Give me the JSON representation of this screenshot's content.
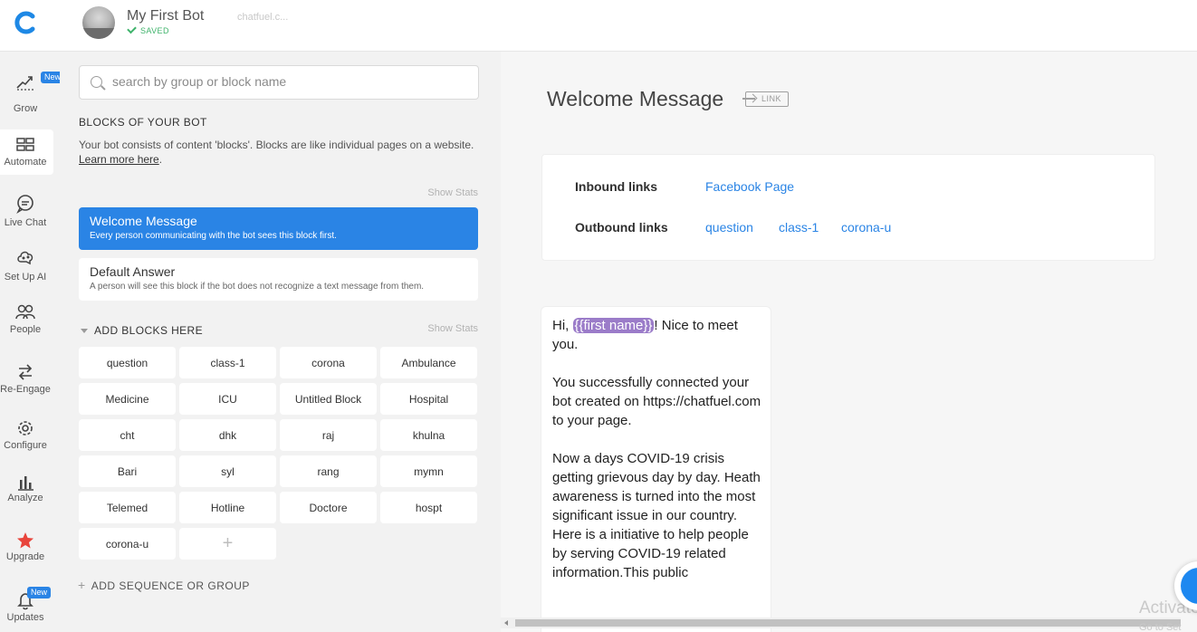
{
  "topbar": {
    "bot_name": "My First Bot",
    "saved": "SAVED",
    "bot_url": "chatfuel.c..."
  },
  "nav": {
    "items": [
      {
        "label": "Grow",
        "icon": "grow-icon",
        "badge": "New"
      },
      {
        "label": "Automate",
        "icon": "automate-icon",
        "active": true
      },
      {
        "label": "Live Chat",
        "icon": "chat-bubble-icon"
      },
      {
        "label": "Set Up AI",
        "icon": "ai-brain-icon"
      },
      {
        "label": "People",
        "icon": "people-icon"
      },
      {
        "label": "Re-Engage",
        "icon": "swap-arrows-icon"
      },
      {
        "label": "Configure",
        "icon": "gear-icon"
      },
      {
        "label": "Analyze",
        "icon": "bar-chart-icon"
      },
      {
        "label": "Upgrade",
        "icon": "star-icon"
      },
      {
        "label": "Updates",
        "icon": "bell-icon",
        "badge": "New"
      }
    ]
  },
  "blocks_panel": {
    "search_placeholder": "search by group or block name",
    "heading": "BLOCKS OF YOUR BOT",
    "description": "Your bot consists of content 'blocks'. Blocks are like individual pages on a website.",
    "learn_more": "Learn more here",
    "show_stats": "Show Stats",
    "pinned": [
      {
        "title": "Welcome Message",
        "subtitle": "Every person communicating with the bot sees this block first.",
        "selected": true
      },
      {
        "title": "Default Answer",
        "subtitle": "A person will see this block if the bot does not recognize a text message from them."
      }
    ],
    "group_title": "ADD BLOCKS HERE",
    "blocks": [
      "question",
      "class-1",
      "corona",
      "Ambulance",
      "Medicine",
      "ICU",
      "Untitled Block",
      "Hospital",
      "cht",
      "dhk",
      "raj",
      "khulna",
      "Bari",
      "syl",
      "rang",
      "mymn",
      "Telemed",
      "Hotline",
      "Doctore",
      "hospt",
      "corona-u"
    ],
    "add_block_symbol": "+",
    "add_sequence": "ADD SEQUENCE OR GROUP"
  },
  "main": {
    "block_title": "Welcome Message",
    "link_label": "LINK",
    "inbound_label": "Inbound links",
    "inbound": [
      "Facebook Page"
    ],
    "outbound_label": "Outbound links",
    "outbound": [
      "question",
      "class-1",
      "corona-u"
    ],
    "message_prefix": "Hi, ",
    "message_variable": "{{first name}}",
    "message_body": "! Nice to meet you.\n\nYou successfully connected your bot created on https://chatfuel.com to your page.\n\nNow a days COVID-19 crisis getting grievous day by day. Heath awareness is turned into the most significant issue in our country.\nHere is a initiative to help people by serving COVID-19 related information.This public"
  },
  "overlay": {
    "activate": "Activate",
    "goto": "Go to Set"
  },
  "colors": {
    "accent": "#2a84e5",
    "saved_green": "#3fb36b",
    "variable_purple": "#9b7cc9",
    "panel_bg": "#f2f2f2",
    "upgrade_star": "#e8453c"
  }
}
